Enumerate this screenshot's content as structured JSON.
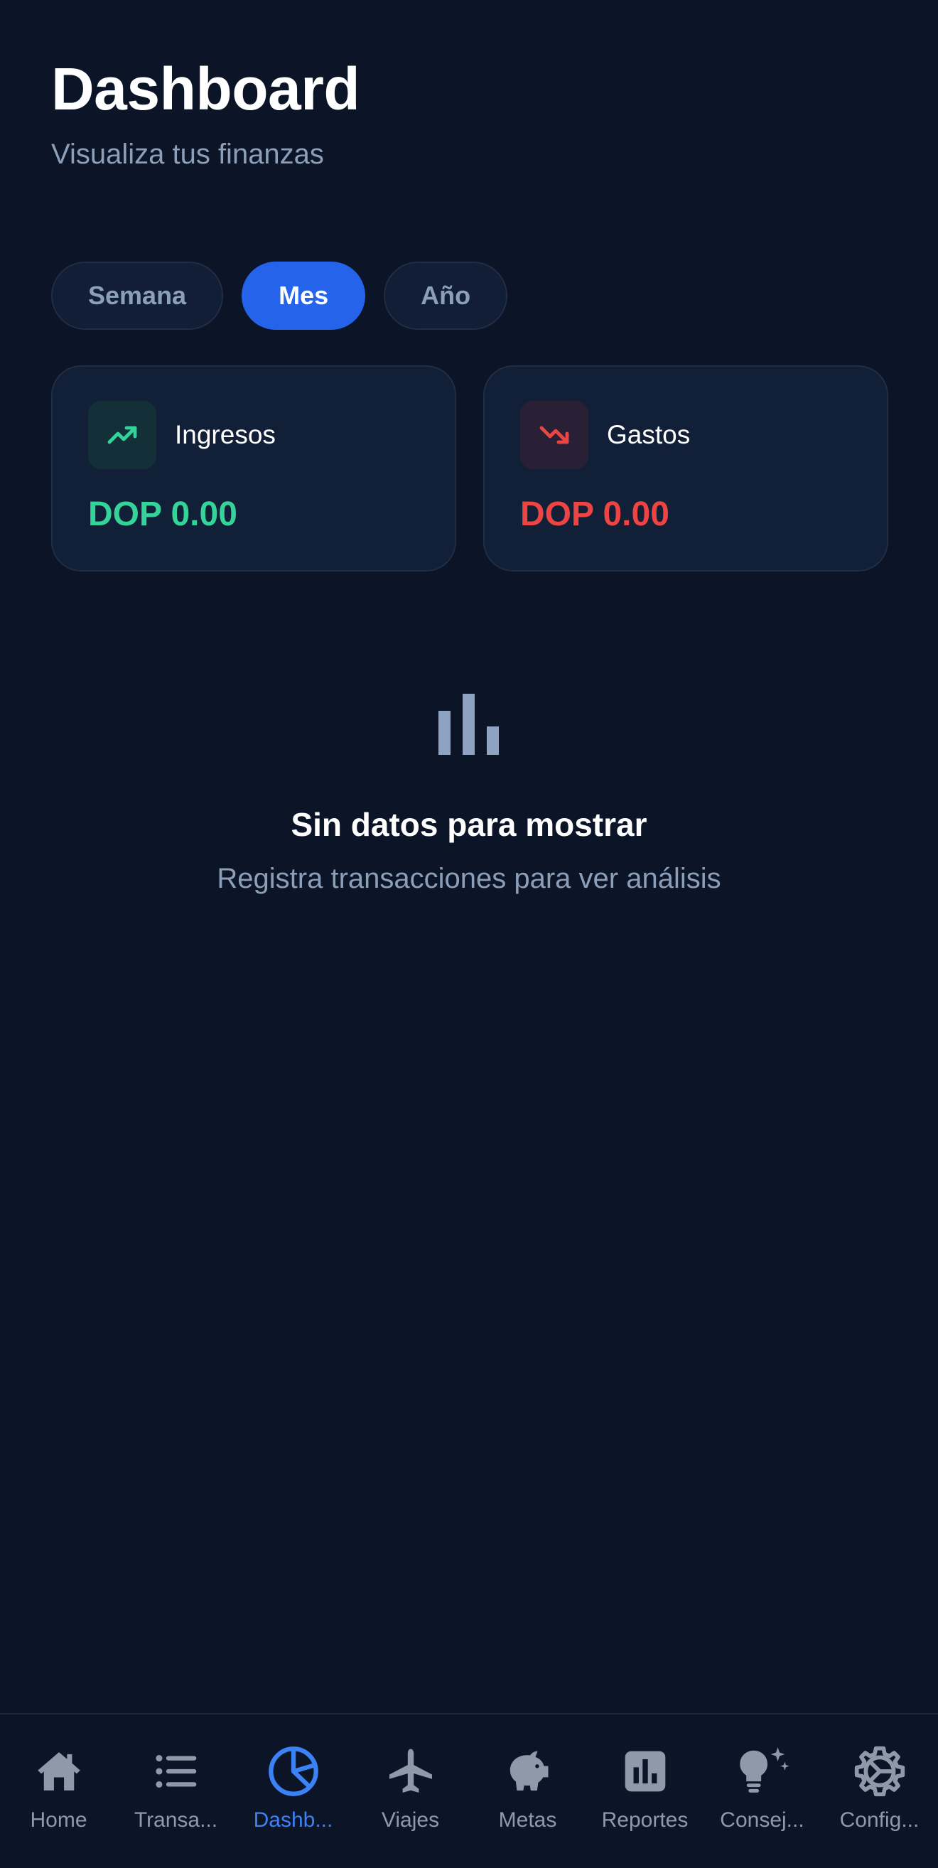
{
  "header": {
    "title": "Dashboard",
    "subtitle": "Visualiza tus finanzas"
  },
  "period_tabs": [
    {
      "label": "Semana",
      "active": false
    },
    {
      "label": "Mes",
      "active": true
    },
    {
      "label": "Año",
      "active": false
    }
  ],
  "cards": {
    "income": {
      "label": "Ingresos",
      "amount": "DOP 0.00",
      "icon": "trending-up-icon",
      "color": "#34d399"
    },
    "expense": {
      "label": "Gastos",
      "amount": "DOP 0.00",
      "icon": "trending-down-icon",
      "color": "#ef4444"
    }
  },
  "empty_state": {
    "icon": "bar-chart-icon",
    "title": "Sin datos para mostrar",
    "text": "Registra transacciones para ver análisis"
  },
  "bottom_nav": [
    {
      "label": "Home",
      "icon": "home-icon",
      "active": false
    },
    {
      "label": "Transa...",
      "icon": "list-icon",
      "active": false
    },
    {
      "label": "Dashb...",
      "icon": "pie-chart-icon",
      "active": true
    },
    {
      "label": "Viajes",
      "icon": "airplane-icon",
      "active": false
    },
    {
      "label": "Metas",
      "icon": "piggy-bank-icon",
      "active": false
    },
    {
      "label": "Reportes",
      "icon": "chart-box-icon",
      "active": false
    },
    {
      "label": "Consej...",
      "icon": "lightbulb-sparkle-icon",
      "active": false
    },
    {
      "label": "Config...",
      "icon": "gear-icon",
      "active": false
    }
  ],
  "colors": {
    "background": "#0b1527",
    "accent": "#2563eb",
    "income": "#34d399",
    "expense": "#ef4444",
    "muted": "#8c9fb9"
  }
}
